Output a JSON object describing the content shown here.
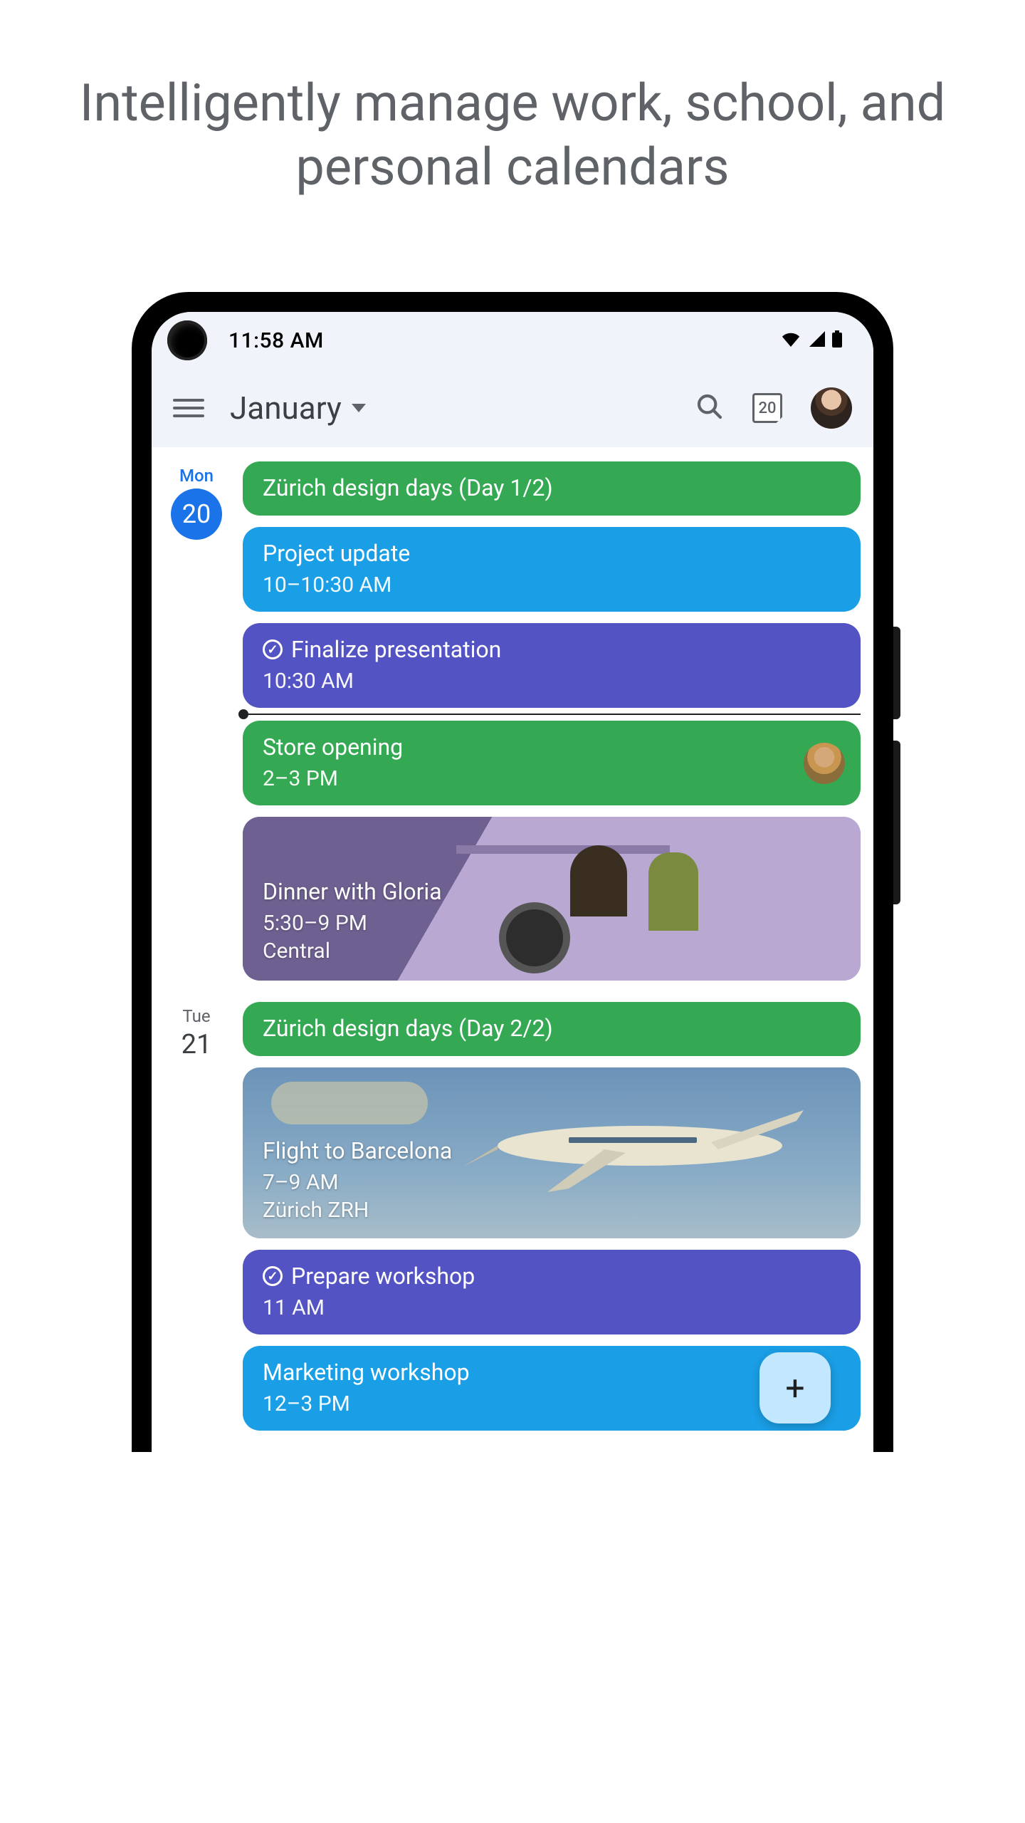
{
  "headline": "Intelligently manage work, school, and personal calendars",
  "statusbar": {
    "time": "11:58 AM"
  },
  "appbar": {
    "month": "January",
    "today_date": "20"
  },
  "fab_glyph": "+",
  "days": [
    {
      "dow": "Mon",
      "date": "20",
      "selected": true,
      "events": [
        {
          "kind": "green",
          "title": "Zürich design days (Day 1/2)"
        },
        {
          "kind": "blue",
          "title": "Project update",
          "time": "10–10:30 AM"
        },
        {
          "kind": "indigo",
          "task": true,
          "title": "Finalize presentation",
          "time": "10:30 AM"
        },
        {
          "nowline": true
        },
        {
          "kind": "green",
          "title": "Store opening",
          "time": "2–3 PM",
          "guest": true
        },
        {
          "kind": "dinner",
          "title": "Dinner with Gloria",
          "time": "5:30–9 PM",
          "loc": "Central"
        }
      ]
    },
    {
      "dow": "Tue",
      "date": "21",
      "selected": false,
      "events": [
        {
          "kind": "green",
          "title": "Zürich design days (Day 2/2)"
        },
        {
          "kind": "flight",
          "title": "Flight to Barcelona",
          "time": "7–9 AM",
          "loc": "Zürich ZRH"
        },
        {
          "kind": "indigo",
          "task": true,
          "title": "Prepare workshop",
          "time": "11 AM"
        },
        {
          "kind": "blue",
          "title": "Marketing workshop",
          "time": "12–3 PM"
        }
      ]
    }
  ]
}
